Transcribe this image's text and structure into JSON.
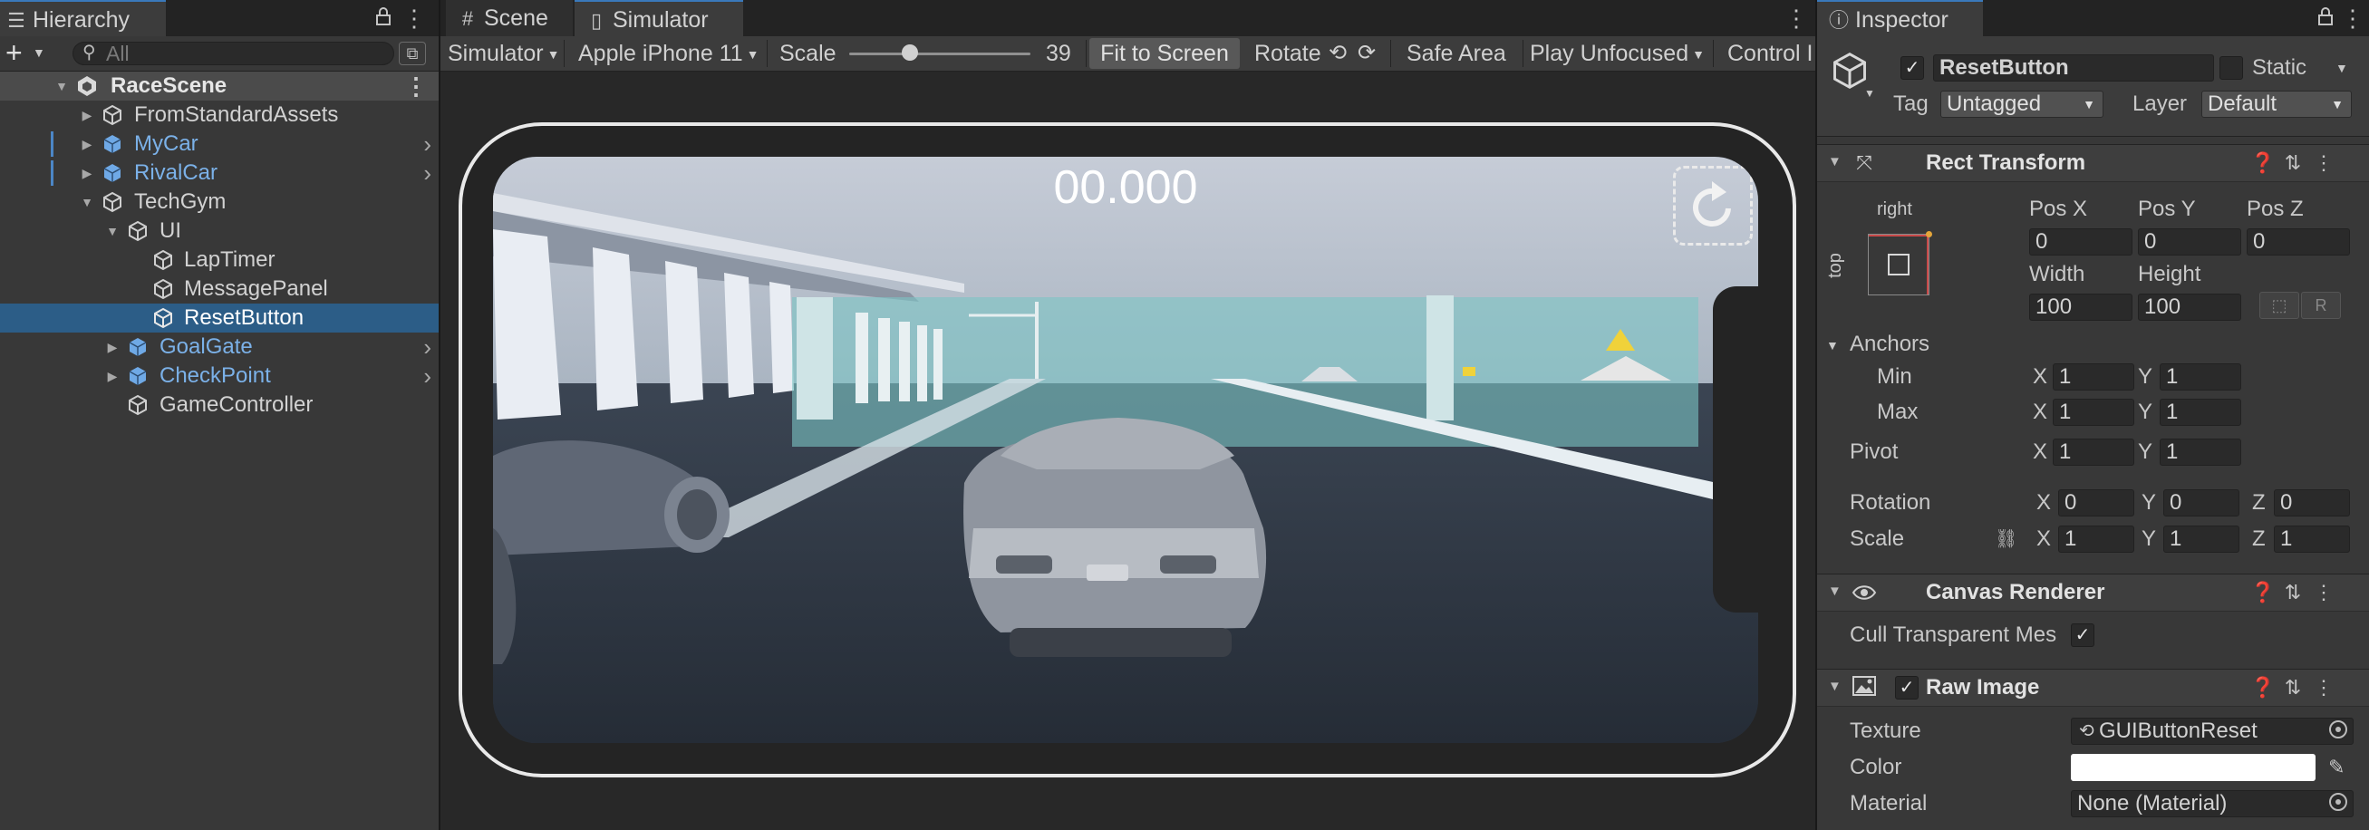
{
  "hierarchy": {
    "tab_label": "Hierarchy",
    "search_placeholder": "All",
    "scene": "RaceScene",
    "items": [
      {
        "label": "FromStandardAssets"
      },
      {
        "label": "MyCar"
      },
      {
        "label": "RivalCar"
      },
      {
        "label": "TechGym"
      },
      {
        "label": "UI"
      },
      {
        "label": "LapTimer"
      },
      {
        "label": "MessagePanel"
      },
      {
        "label": "ResetButton"
      },
      {
        "label": "GoalGate"
      },
      {
        "label": "CheckPoint"
      },
      {
        "label": "GameController"
      }
    ]
  },
  "simulator": {
    "tabs": [
      {
        "label": "Scene"
      },
      {
        "label": "Simulator"
      }
    ],
    "toolbar": {
      "mode": "Simulator",
      "device": "Apple iPhone 11",
      "scale_label": "Scale",
      "scale_value": "39",
      "fit_label": "Fit to Screen",
      "rotate_label": "Rotate",
      "safe_area_label": "Safe Area",
      "play_unfocused_label": "Play Unfocused",
      "control_label": "Control I"
    },
    "game": {
      "timer": "00.000"
    }
  },
  "inspector": {
    "tab_label": "Inspector",
    "object_name": "ResetButton",
    "static_label": "Static",
    "tag_label": "Tag",
    "tag_value": "Untagged",
    "layer_label": "Layer",
    "layer_value": "Default",
    "rect_transform": {
      "title": "Rect Transform",
      "anchor_h": "right",
      "anchor_v": "top",
      "pos_x_label": "Pos X",
      "pos_x": "0",
      "pos_y_label": "Pos Y",
      "pos_y": "0",
      "pos_z_label": "Pos Z",
      "pos_z": "0",
      "width_label": "Width",
      "width": "100",
      "height_label": "Height",
      "height": "100",
      "r_label": "R",
      "anchors_label": "Anchors",
      "min_label": "Min",
      "min_x": "1",
      "min_y": "1",
      "max_label": "Max",
      "max_x": "1",
      "max_y": "1",
      "pivot_label": "Pivot",
      "pivot_x": "1",
      "pivot_y": "1",
      "rotation_label": "Rotation",
      "rot_x": "0",
      "rot_y": "0",
      "rot_z": "0",
      "scale_label": "Scale",
      "scale_x": "1",
      "scale_y": "1",
      "scale_z": "1",
      "x": "X",
      "y": "Y",
      "z": "Z"
    },
    "canvas_renderer": {
      "title": "Canvas Renderer",
      "cull_label": "Cull Transparent Mes"
    },
    "raw_image": {
      "title": "Raw Image",
      "texture_label": "Texture",
      "texture_value": "GUIButtonReset",
      "color_label": "Color",
      "color_value": "#ffffff",
      "material_label": "Material",
      "material_value": "None (Material)"
    }
  },
  "colors": {
    "accent": "#3a79bb",
    "selection": "#2c5d87",
    "prefab_text": "#7bb1e8"
  }
}
